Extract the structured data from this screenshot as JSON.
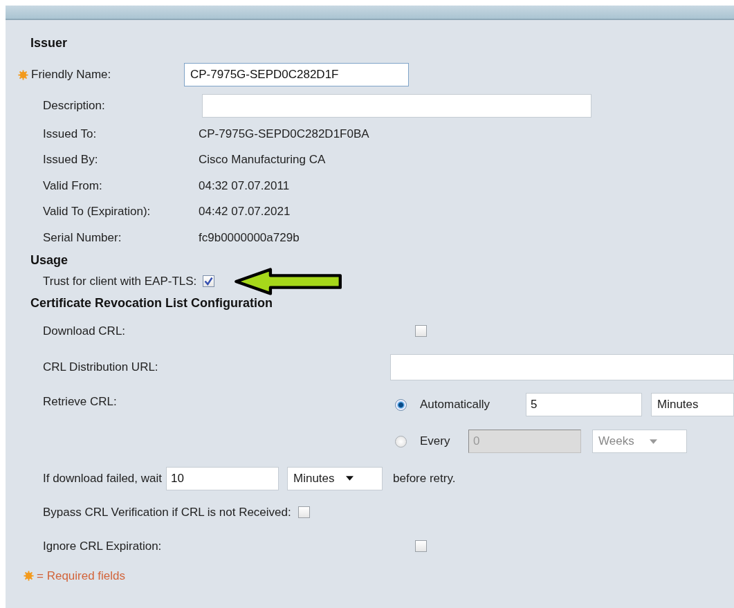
{
  "issuer": {
    "title": "Issuer",
    "friendly_name": {
      "label": "Friendly Name:",
      "required": true,
      "value": "CP-7975G-SEPD0C282D1F"
    },
    "description": {
      "label": "Description:"
    },
    "details": [
      {
        "label": "Issued To:",
        "value": "CP-7975G-SEPD0C282D1F0BA"
      },
      {
        "label": "Issued By:",
        "value": "Cisco Manufacturing CA"
      },
      {
        "label": "Valid From:",
        "value": "04:32 07.07.2011"
      },
      {
        "label": "Valid To (Expiration):",
        "value": "04:42 07.07.2021"
      },
      {
        "label": "Serial Number:",
        "value": "fc9b0000000a729b"
      }
    ]
  },
  "usage": {
    "title": "Usage",
    "trust": {
      "label": "Trust for client with EAP-TLS:",
      "checked": true
    }
  },
  "crl": {
    "title": "Certificate Revocation List Configuration",
    "download": {
      "label": "Download CRL:",
      "checked": false
    },
    "url": {
      "label": "CRL Distribution URL:"
    },
    "retrieve": {
      "label": "Retrieve CRL:",
      "options": [
        {
          "label": "Automatically",
          "selected": true,
          "value": "5",
          "unit": "Minutes",
          "disabled": false
        },
        {
          "label": "Every",
          "selected": false,
          "value": "0",
          "unit": "Weeks",
          "disabled": true
        }
      ]
    },
    "retry": {
      "before": "If download failed, wait",
      "value": "10",
      "unit": "Minutes",
      "after": "before retry."
    },
    "bypass": {
      "label": "Bypass CRL Verification if CRL is not Received:",
      "checked": false
    },
    "ignore": {
      "label": "Ignore CRL Expiration:",
      "checked": false
    }
  },
  "footer": {
    "legend": "= Required fields"
  }
}
